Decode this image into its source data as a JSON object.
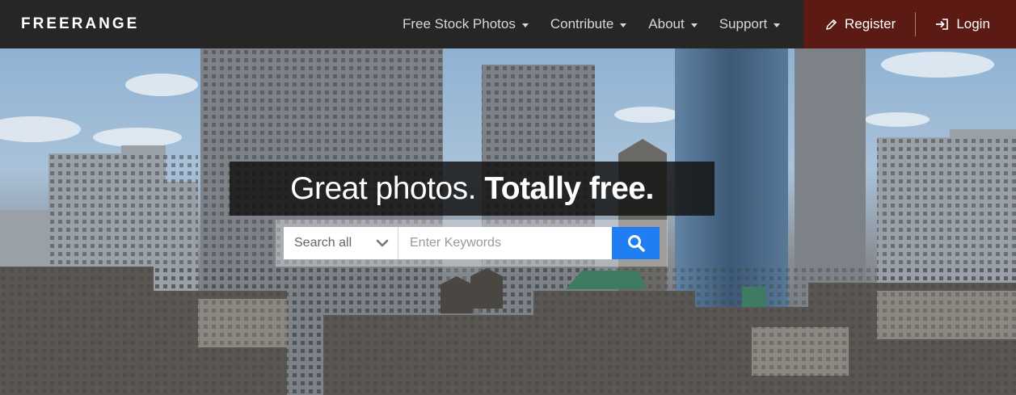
{
  "brand": {
    "name": "FREERANGE"
  },
  "nav": {
    "items": [
      {
        "label": "Free Stock Photos"
      },
      {
        "label": "Contribute"
      },
      {
        "label": "About"
      },
      {
        "label": "Support"
      }
    ]
  },
  "account": {
    "register_label": "Register",
    "login_label": "Login"
  },
  "hero": {
    "headline_regular": "Great photos. ",
    "headline_bold": "Totally free."
  },
  "search": {
    "scope_selected": "Search all",
    "placeholder": "Enter Keywords",
    "value": ""
  },
  "icons": {
    "nav_caret": "caret-down-icon",
    "register": "pencil-icon",
    "login": "sign-in-icon",
    "scope_chevron": "chevron-down-icon",
    "search_button": "search-icon"
  },
  "colors": {
    "nav_bg": "#262626",
    "account_bg": "#5c1a14",
    "search_button": "#1f7ef2"
  }
}
